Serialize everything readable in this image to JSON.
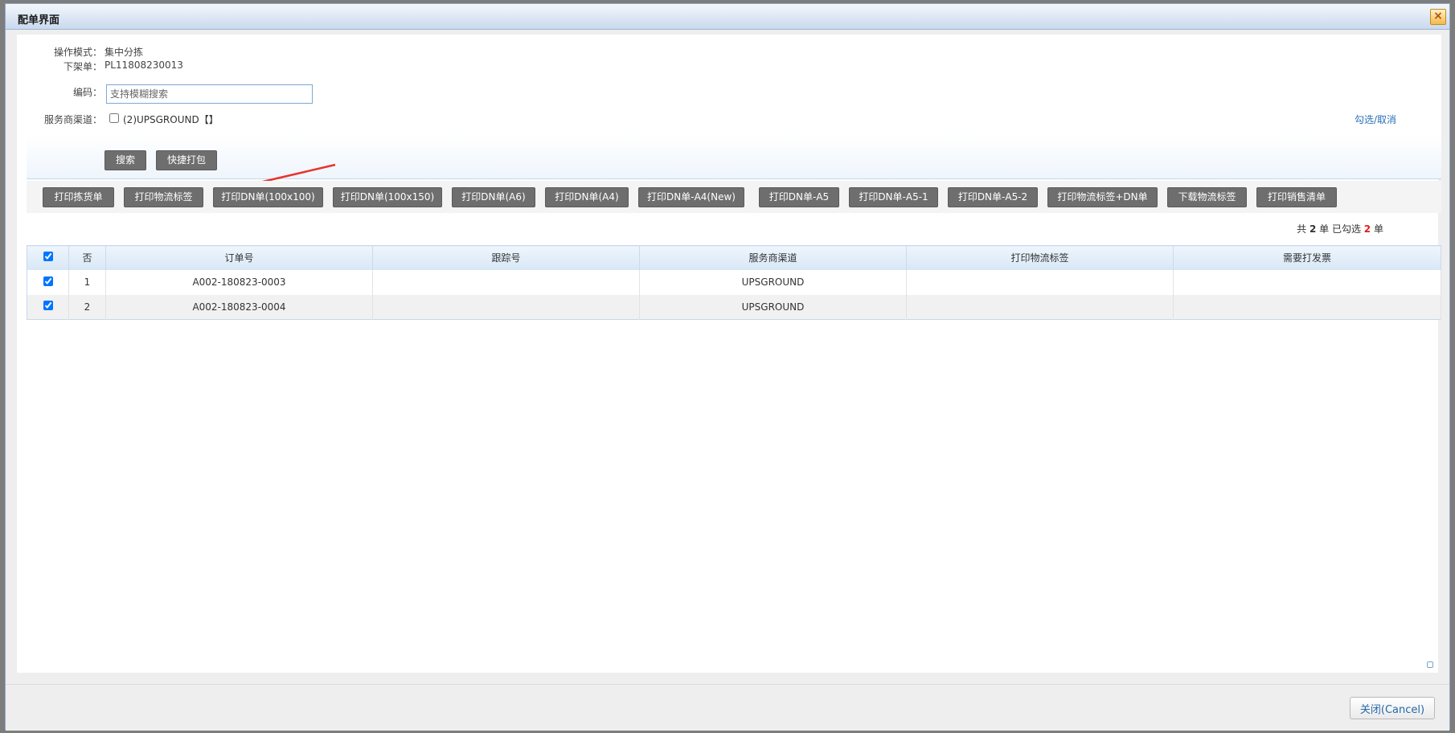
{
  "dialog": {
    "title": "配单界面",
    "close_icon": "×"
  },
  "form": {
    "mode_label": "操作模式：",
    "mode_value": "集中分拣",
    "picklist_label": "下架单：",
    "picklist_value": "PL11808230013",
    "code_label": "编码：",
    "code_placeholder": "支持模糊搜索",
    "channel_label": "服务商渠道：",
    "channel_option": "(2)UPSGROUND【】",
    "toggle_link": "勾选/取消",
    "search_button": "搜索",
    "quick_pack_button": "快捷打包"
  },
  "toolbar": {
    "buttons": [
      "打印拣货单",
      "打印物流标签",
      "打印DN单(100x100)",
      "打印DN单(100x150)",
      "打印DN单(A6)",
      "打印DN单(A4)",
      "打印DN单-A4(New)",
      "打印DN单-A5",
      "打印DN单-A5-1",
      "打印DN单-A5-2",
      "打印物流标签+DN单",
      "下载物流标签",
      "打印销售清单"
    ]
  },
  "summary": {
    "prefix": "共",
    "total": "2",
    "mid": "单  已勾选",
    "selected": "2",
    "suffix": "单"
  },
  "table": {
    "headers": [
      "否",
      "订单号",
      "跟踪号",
      "服务商渠道",
      "打印物流标签",
      "需要打发票"
    ],
    "rows": [
      {
        "checked": true,
        "no": "1",
        "order": "A002-180823-0003",
        "tracking": "",
        "channel": "UPSGROUND",
        "label": "",
        "invoice": ""
      },
      {
        "checked": true,
        "no": "2",
        "order": "A002-180823-0004",
        "tracking": "",
        "channel": "UPSGROUND",
        "label": "",
        "invoice": ""
      }
    ]
  },
  "footer": {
    "cancel_button": "关闭(Cancel)"
  },
  "colors": {
    "accent_arrow": "#e8332a",
    "link": "#2a6fb6",
    "button_dark": "#6e6e6e"
  }
}
